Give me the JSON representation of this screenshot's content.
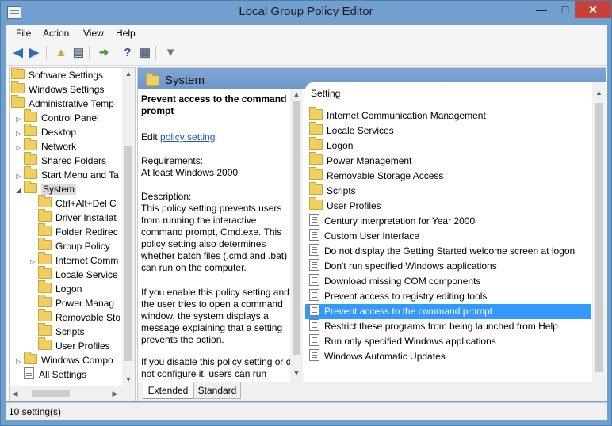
{
  "window": {
    "title": "Local Group Policy Editor",
    "min": "—",
    "max": "□",
    "close": "✕"
  },
  "menu": [
    {
      "label": "File"
    },
    {
      "label": "Action"
    },
    {
      "label": "View"
    },
    {
      "label": "Help"
    }
  ],
  "toolbar": [
    {
      "name": "back-icon",
      "glyph": "◀"
    },
    {
      "name": "forward-icon",
      "glyph": "▶"
    },
    {
      "name": "up-folder-icon",
      "glyph": "▲"
    },
    {
      "name": "show-hide-tree-icon",
      "glyph": "▤"
    },
    {
      "name": "export-list-icon",
      "glyph": "➜"
    },
    {
      "name": "help-icon",
      "glyph": "?"
    },
    {
      "name": "properties-icon",
      "glyph": "▦"
    },
    {
      "name": "filter-icon",
      "glyph": "▼"
    }
  ],
  "tree": [
    {
      "label": "Software Settings",
      "depth": 0,
      "expander": ""
    },
    {
      "label": "Windows Settings",
      "depth": 0,
      "expander": ""
    },
    {
      "label": "Administrative Temp",
      "depth": 0,
      "expander": ""
    },
    {
      "label": "Control Panel",
      "depth": 1,
      "expander": "▷"
    },
    {
      "label": "Desktop",
      "depth": 1,
      "expander": "▷"
    },
    {
      "label": "Network",
      "depth": 1,
      "expander": "▷"
    },
    {
      "label": "Shared Folders",
      "depth": 1,
      "expander": ""
    },
    {
      "label": "Start Menu and Ta",
      "depth": 1,
      "expander": "▷"
    },
    {
      "label": "System",
      "depth": 1,
      "expander": "◢",
      "selected": true
    },
    {
      "label": "Ctrl+Alt+Del C",
      "depth": 2,
      "expander": ""
    },
    {
      "label": "Driver Installat",
      "depth": 2,
      "expander": ""
    },
    {
      "label": "Folder Redirec",
      "depth": 2,
      "expander": ""
    },
    {
      "label": "Group Policy",
      "depth": 2,
      "expander": ""
    },
    {
      "label": "Internet Comm",
      "depth": 2,
      "expander": "▷"
    },
    {
      "label": "Locale Service",
      "depth": 2,
      "expander": ""
    },
    {
      "label": "Logon",
      "depth": 2,
      "expander": ""
    },
    {
      "label": "Power Manag",
      "depth": 2,
      "expander": ""
    },
    {
      "label": "Removable Sto",
      "depth": 2,
      "expander": ""
    },
    {
      "label": "Scripts",
      "depth": 2,
      "expander": ""
    },
    {
      "label": "User Profiles",
      "depth": 2,
      "expander": ""
    },
    {
      "label": "Windows Compo",
      "depth": 1,
      "expander": "▷"
    },
    {
      "label": "All Settings",
      "depth": 1,
      "expander": "",
      "icon": "settings"
    }
  ],
  "panel": {
    "folder_title": "System",
    "policy_title": "Prevent access to the command prompt",
    "edit_prefix": "Edit ",
    "edit_link": "policy setting",
    "requirements_label": "Requirements:",
    "requirements_value": "At least Windows 2000",
    "description_label": "Description:",
    "description_1": "This policy setting prevents users from running the interactive command prompt, Cmd.exe.  This policy setting also determines whether batch files (.cmd and .bat) can run on the computer.",
    "description_2": "If you enable this policy setting and the user tries to open a command window, the system displays a message explaining that a setting prevents the action.",
    "description_3": "If you disable this policy setting or do not configure it, users can run Cmd.exe and batch files normally."
  },
  "list": {
    "header": "Setting",
    "sort_glyph": "ˆ",
    "items": [
      {
        "label": "Internet Communication Management",
        "type": "folder"
      },
      {
        "label": "Locale Services",
        "type": "folder"
      },
      {
        "label": "Logon",
        "type": "folder"
      },
      {
        "label": "Power Management",
        "type": "folder"
      },
      {
        "label": "Removable Storage Access",
        "type": "folder"
      },
      {
        "label": "Scripts",
        "type": "folder"
      },
      {
        "label": "User Profiles",
        "type": "folder"
      },
      {
        "label": "Century interpretation for Year 2000",
        "type": "setting"
      },
      {
        "label": "Custom User Interface",
        "type": "setting"
      },
      {
        "label": "Do not display the Getting Started welcome screen at logon",
        "type": "setting"
      },
      {
        "label": "Don't run specified Windows applications",
        "type": "setting"
      },
      {
        "label": "Download missing COM components",
        "type": "setting"
      },
      {
        "label": "Prevent access to registry editing tools",
        "type": "setting"
      },
      {
        "label": "Prevent access to the command prompt",
        "type": "setting",
        "selected": true
      },
      {
        "label": "Restrict these programs from being launched from Help",
        "type": "setting"
      },
      {
        "label": "Run only specified Windows applications",
        "type": "setting"
      },
      {
        "label": "Windows Automatic Updates",
        "type": "setting"
      }
    ]
  },
  "tabs": [
    {
      "label": "Extended"
    },
    {
      "label": "Standard"
    }
  ],
  "status": {
    "text": "10 setting(s)"
  },
  "colors": {
    "selection": "#3399ff",
    "title_bar": "#71a0cf",
    "close_button": "#c7413a",
    "link": "#1c58b4"
  }
}
